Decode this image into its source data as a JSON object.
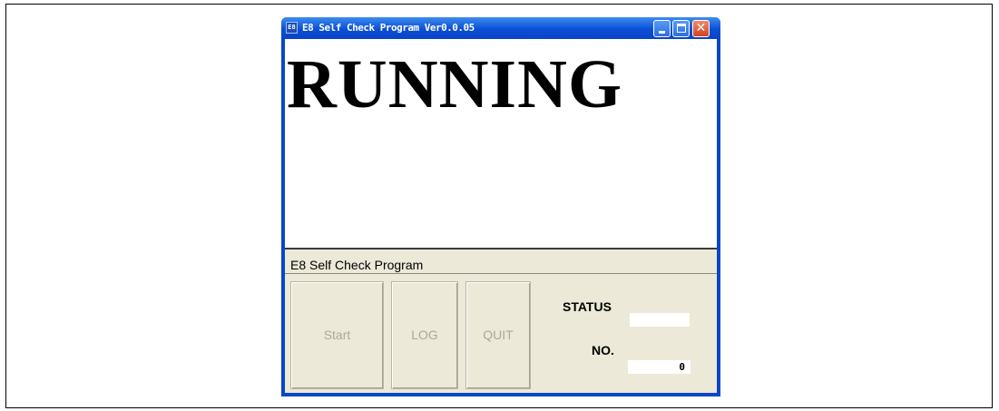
{
  "window": {
    "icon_text": "E8",
    "title": "E8 Self Check Program Ver0.0.05"
  },
  "canvas": {
    "message": "RUNNING"
  },
  "statusbar": {
    "text": "E8 Self Check Program"
  },
  "buttons": {
    "start": "Start",
    "log": "LOG",
    "quit": "QUIT"
  },
  "panel": {
    "status_label": "STATUS",
    "status_value": "",
    "no_label": "NO.",
    "no_value": "0"
  },
  "colors": {
    "titlebar": "#0b4fd6",
    "close_button": "#d4431e",
    "face": "#ece9d8",
    "disabled_text": "#aca899"
  }
}
